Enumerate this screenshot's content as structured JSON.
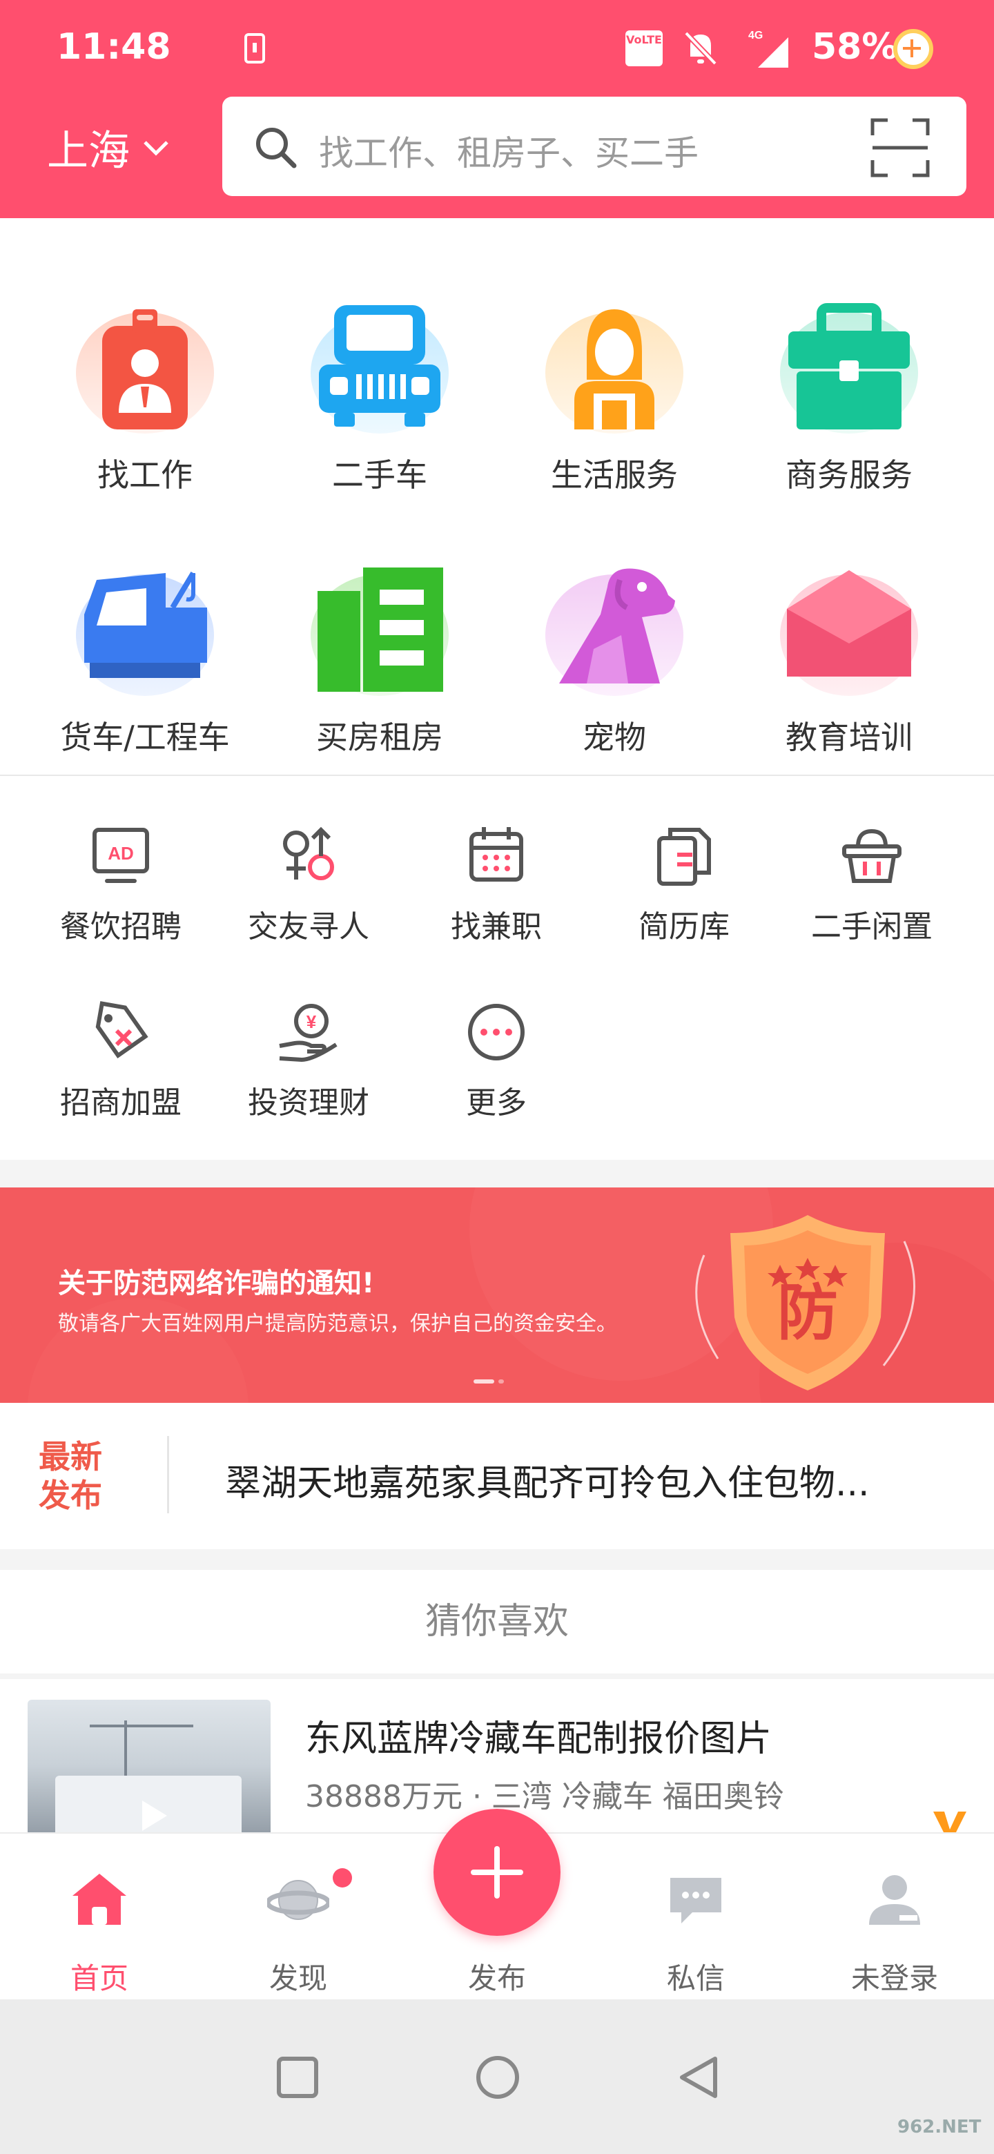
{
  "status_bar": {
    "time": "11:48",
    "volte": "VoLTE",
    "network": "4G",
    "battery": "58%"
  },
  "header": {
    "city": "上海",
    "search_placeholder": "找工作、租房子、买二手"
  },
  "main_categories": [
    {
      "label": "找工作",
      "icon": "job-badge-icon",
      "color": "#f4604a"
    },
    {
      "label": "二手车",
      "icon": "car-icon",
      "color": "#1ea6f0"
    },
    {
      "label": "生活服务",
      "icon": "service-person-icon",
      "color": "#ffa21a"
    },
    {
      "label": "商务服务",
      "icon": "briefcase-icon",
      "color": "#17c596"
    },
    {
      "label": "货车/工程车",
      "icon": "truck-icon",
      "color": "#3a7bf0"
    },
    {
      "label": "买房租房",
      "icon": "building-icon",
      "color": "#37bc2c"
    },
    {
      "label": "宠物",
      "icon": "dog-icon",
      "color": "#d25ad8"
    },
    {
      "label": "教育培训",
      "icon": "envelope-cap-icon",
      "color": "#f25274"
    }
  ],
  "secondary_categories": [
    {
      "label": "餐饮招聘",
      "icon": "ad-screen-icon"
    },
    {
      "label": "交友寻人",
      "icon": "gender-icon"
    },
    {
      "label": "找兼职",
      "icon": "calendar-icon"
    },
    {
      "label": "简历库",
      "icon": "document-stack-icon"
    },
    {
      "label": "二手闲置",
      "icon": "basket-icon"
    },
    {
      "label": "招商加盟",
      "icon": "tag-icon"
    },
    {
      "label": "投资理财",
      "icon": "money-hand-icon"
    },
    {
      "label": "更多",
      "icon": "more-icon"
    }
  ],
  "banner": {
    "title": "关于防范网络诈骗的通知!",
    "subtitle": "敬请各广大百姓网用户提高防范意识，保护自己的资金安全。",
    "shield_text": "防"
  },
  "latest": {
    "tag_line1": "最新",
    "tag_line2": "发布",
    "text": "翠湖天地嘉苑家具配齐可拎包入住包物..."
  },
  "guess_title": "猜你喜欢",
  "listing": {
    "title": "东风蓝牌冷藏车配制报价图片",
    "meta": "38888万元  ·  三湾 冷藏车 福田奥铃"
  },
  "bottom_nav": [
    {
      "label": "首页",
      "icon": "home-icon",
      "active": true
    },
    {
      "label": "发现",
      "icon": "planet-icon",
      "active": false
    },
    {
      "label": "发布",
      "icon": "plus-icon",
      "active": false
    },
    {
      "label": "私信",
      "icon": "chat-icon",
      "active": false
    },
    {
      "label": "未登录",
      "icon": "user-icon",
      "active": false
    }
  ],
  "watermark": "962.NET",
  "colors": {
    "brand": "#ff4f6e",
    "banner": "#f35a5e",
    "latest_tag": "#ef5a4a"
  }
}
